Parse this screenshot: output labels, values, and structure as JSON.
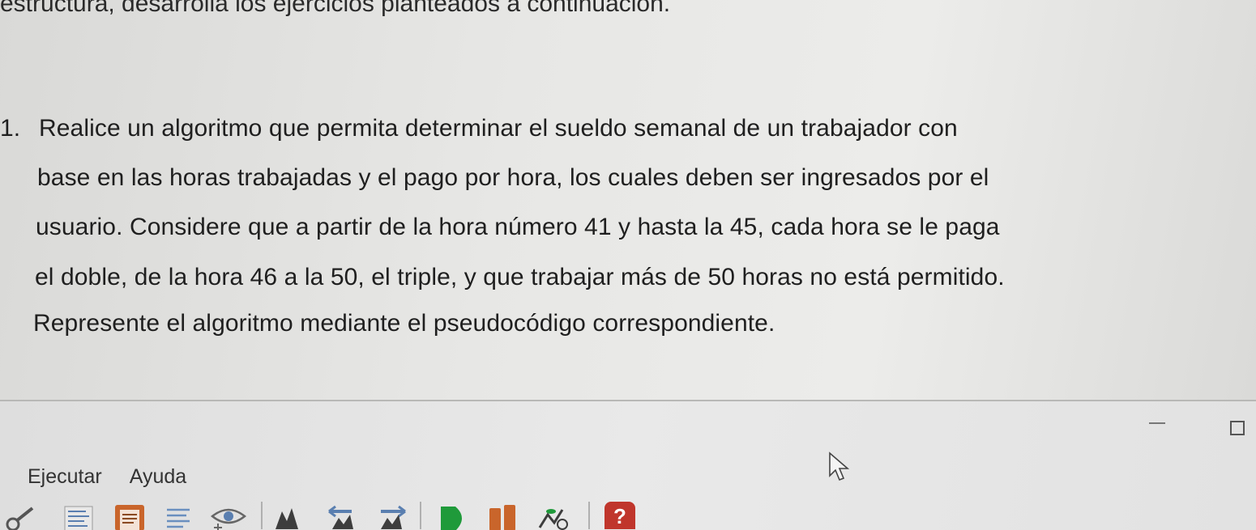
{
  "document": {
    "top_line": "estructura, desarrolla los ejercicios planteados a continuación.",
    "exercise": {
      "number": "1.",
      "lines": [
        "Realice un algoritmo que permita determinar el sueldo semanal de un trabajador con",
        "base en las horas trabajadas y el pago por hora, los cuales deben ser ingresados por el",
        "usuario. Considere que a partir de la hora número 41 y hasta la 45, cada hora se le paga",
        "el doble, de la hora 46 a la 50, el triple, y que trabajar más de 50 horas no está permitido.",
        "Represente el algoritmo mediante el pseudocódigo correspondiente."
      ]
    }
  },
  "menubar": {
    "items": [
      {
        "label": "Ejecutar"
      },
      {
        "label": "Ayuda"
      }
    ]
  },
  "toolbar": {
    "icons": [
      "run-icon",
      "list-icon",
      "document-icon",
      "text-icon",
      "eye-icon",
      "step-icon",
      "back-icon",
      "forward-icon",
      "play-icon",
      "stop-icon",
      "plant-icon",
      "help-icon"
    ],
    "help_symbol": "?"
  },
  "colors": {
    "text": "#1f1f1f",
    "play_green": "#1f9a3a",
    "stop_orange": "#c9652b",
    "help_red": "#c0362c",
    "toolbar_blue": "#5a7fb0"
  }
}
